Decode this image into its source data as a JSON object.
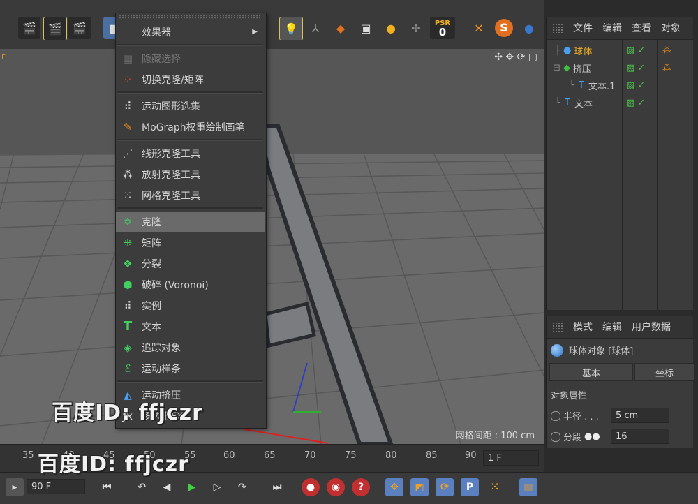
{
  "menu": {
    "header": "效果器",
    "items": [
      {
        "label": "隐藏选择",
        "icon": "hide-selection-icon",
        "disabled": true
      },
      {
        "label": "切换克隆/矩阵",
        "icon": "toggle-clone-icon"
      },
      {
        "label": "运动图形选集",
        "icon": "mograph-selection-icon"
      },
      {
        "label": "MoGraph权重绘制画笔",
        "icon": "weight-brush-icon"
      },
      {
        "label": "线形克隆工具",
        "icon": "linear-clone-icon"
      },
      {
        "label": "放射克隆工具",
        "icon": "radial-clone-icon"
      },
      {
        "label": "网格克隆工具",
        "icon": "grid-clone-icon"
      },
      {
        "label": "克隆",
        "icon": "cloner-icon",
        "selected": true
      },
      {
        "label": "矩阵",
        "icon": "matrix-icon"
      },
      {
        "label": "分裂",
        "icon": "fracture-icon"
      },
      {
        "label": "破碎 (Voronoi)",
        "icon": "voronoi-icon"
      },
      {
        "label": "实例",
        "icon": "instance-icon"
      },
      {
        "label": "文本",
        "icon": "text-icon"
      },
      {
        "label": "追踪对象",
        "icon": "tracer-icon"
      },
      {
        "label": "运动样条",
        "icon": "spline-icon"
      },
      {
        "label": "运动挤压",
        "icon": "extrude-icon"
      },
      {
        "label": "多边形FX",
        "icon": "polyfx-icon"
      }
    ]
  },
  "toolbar": {
    "psr_label": "PSR",
    "psr_value": "0",
    "viewport_label": "r"
  },
  "object_manager": {
    "tabs": [
      "文件",
      "编辑",
      "查看",
      "对象"
    ],
    "objects": [
      {
        "name": "球体",
        "highlight": true
      },
      {
        "name": "挤压"
      },
      {
        "name": "文本.1"
      },
      {
        "name": "文本"
      }
    ]
  },
  "attribute_manager": {
    "tabs": [
      "模式",
      "编辑",
      "用户数据"
    ],
    "object_title": "球体对象 [球体]",
    "tab_basic": "基本",
    "tab_coord": "坐标",
    "section": "对象属性",
    "radius_label": "半径 . . .",
    "radius_value": "5 cm",
    "segments_label": "分段",
    "segments_value": "16"
  },
  "viewport": {
    "grid_spacing": "网格间距 : 100 cm"
  },
  "timeline": {
    "ticks": [
      "35",
      "40",
      "45",
      "50",
      "55",
      "60",
      "65",
      "70",
      "75",
      "80",
      "85",
      "90"
    ],
    "current_frame": "1 F",
    "end_frame": "90 F"
  },
  "watermark": {
    "text1": "百度ID: ffjczr",
    "text2": "百度ID: ffjczr"
  }
}
